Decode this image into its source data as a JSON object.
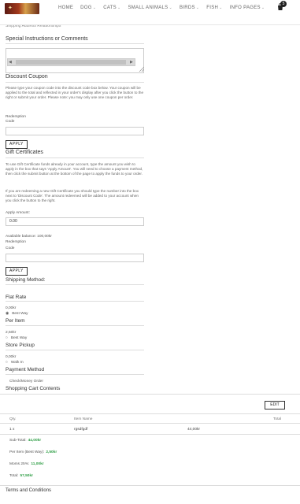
{
  "header": {
    "nav": [
      {
        "label": "HOME",
        "has_menu": false
      },
      {
        "label": "DOG",
        "has_menu": true
      },
      {
        "label": "CATS",
        "has_menu": true
      },
      {
        "label": "SMALL ANIMALS",
        "has_menu": true
      },
      {
        "label": "BIRDS",
        "has_menu": true
      },
      {
        "label": "FISH",
        "has_menu": true
      },
      {
        "label": "INFO PAGES",
        "has_menu": true
      }
    ],
    "cart_count": "5",
    "chevron": "⌄"
  },
  "cut_text": "Shipping Address Relationships",
  "special_instructions": {
    "title": "Special Instructions or Comments"
  },
  "discount": {
    "title": "Discount Coupon",
    "description": "Please type your coupon code into the discount code box below. Your coupon will be applied to the total and reflected in your order's display after you click the button to the right or submit your order. Please note: you may only use one coupon per order.",
    "redemption_label_1": "Redemption",
    "redemption_label_2": "Code",
    "apply_label": "APPLY"
  },
  "gift": {
    "title": "Gift Certificates",
    "description_1": "To use Gift Certificate funds already in your account, type the amount you wish to apply in the box that says 'Apply Amount'. You will need to choose a payment method, then click the submit button at the bottom of the page to apply the funds to your order.",
    "description_2": "If you are redeeming a new Gift Certificate you should type the number into the box next to 'Discount Code'. The amount redeemed will be added to your account when you click the button to the right.",
    "apply_amount_label": "Apply Amount:",
    "apply_amount_value": "0.00",
    "balance": "Available balance: 100,00kr",
    "redemption_label_1": "Redemption",
    "redemption_label_2": "Code",
    "apply_label": "APPLY"
  },
  "shipping": {
    "title": "Shipping Method:",
    "options": [
      {
        "name": "Flat Rate",
        "price": "0,00kr",
        "option": "Best Way"
      },
      {
        "name": "Per Item",
        "price": "2,50kr",
        "option": "Best Way"
      },
      {
        "name": "Store Pickup",
        "price": "0,00kr",
        "option": "Walk In"
      }
    ]
  },
  "payment": {
    "title": "Payment Method",
    "option": "Check/Money Order"
  },
  "cart": {
    "title": "Shopping Cart Contents",
    "edit_label": "EDIT",
    "columns": {
      "qty": "Qty.",
      "item": "Item Name",
      "total": "Total"
    },
    "row": {
      "qty": "1 x",
      "item": "rgsdfgdf",
      "price": "44,00kr"
    },
    "totals": [
      {
        "label": "Sub-Total:",
        "value": "44,00kr"
      },
      {
        "label": "Per Item (Best Way):",
        "value": "2,50kr"
      },
      {
        "label": "Moms 25%:",
        "value": "11,00kr"
      },
      {
        "label": "Total:",
        "value": "57,50kr"
      }
    ]
  },
  "terms": "Terms and Conditions",
  "colors": {
    "accent_green": "#2e9e45",
    "border": "#cccccc"
  }
}
